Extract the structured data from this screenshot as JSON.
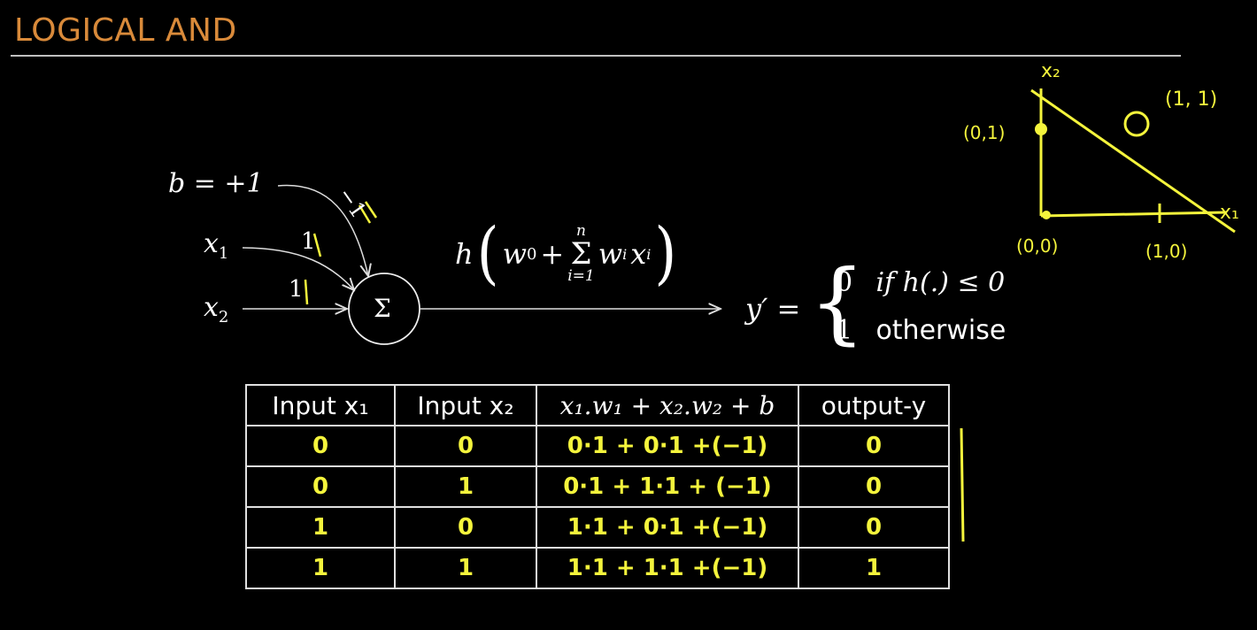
{
  "slide": {
    "title": "LOGICAL AND"
  },
  "perceptron": {
    "bias_label": "b = +1",
    "x1_label": "x",
    "x1_sub": "1",
    "x2_label": "x",
    "x2_sub": "2",
    "sum_symbol": "Σ",
    "func_h": "h",
    "func_w0": "w",
    "func_w0_sub": "0",
    "func_plus": "+",
    "func_sum": "Σ",
    "func_sum_top": "n",
    "func_sum_bottom": "i=1",
    "func_wi": "w",
    "func_wi_sub": "i",
    "func_xi": "x",
    "func_xi_sub": "i",
    "weight_b": "−1",
    "weight_x1": "1",
    "weight_x2": "1",
    "output_var": "y′ =",
    "case1_val": "0",
    "case1_cond": "if h(.) ≤ 0",
    "case2_val": "1",
    "case2_cond": "otherwise"
  },
  "table": {
    "headers": [
      "Input x₁",
      "Input x₂",
      "x₁.w₁ + x₂.w₂ + b",
      "output-y"
    ],
    "rows": [
      [
        "0",
        "0",
        "0·1 + 0·1 +(−1)",
        "0"
      ],
      [
        "0",
        "1",
        "0·1 + 1·1 + (−1)",
        "0"
      ],
      [
        "1",
        "0",
        "1·1 + 0·1 +(−1)",
        "0"
      ],
      [
        "1",
        "1",
        "1·1 + 1·1 +(−1)",
        "1"
      ]
    ]
  },
  "plot": {
    "axis_x": "x₁",
    "axis_y": "x₂",
    "p00": "(0,0)",
    "p01": "(0,1)",
    "p10": "(1,0)",
    "p11": "(1, 1)"
  },
  "colors": {
    "title": "#d98a3a",
    "handwriting": "#f4f43c",
    "background": "#000000"
  }
}
